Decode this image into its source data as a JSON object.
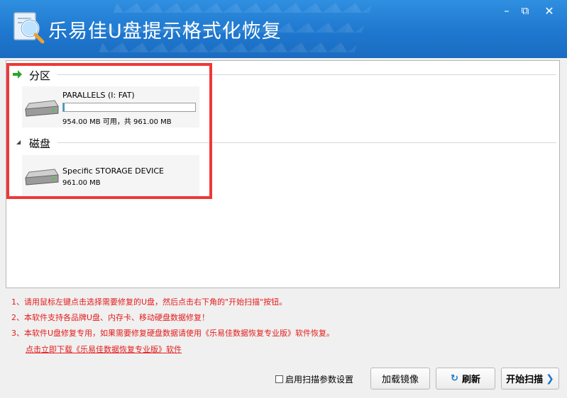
{
  "window": {
    "title": "乐易佳U盘提示格式化恢复",
    "minimize_symbol": "–",
    "maximize_symbol": "⧉",
    "close_symbol": "✕"
  },
  "sections": {
    "partitions": {
      "label": "分区",
      "items": [
        {
          "name": "PARALLELS (I: FAT)",
          "free_text": "954.00 MB 可用，共 961.00 MB",
          "used_fraction": 0.007,
          "icon": "hard-drive-icon"
        }
      ]
    },
    "disks": {
      "label": "磁盘",
      "items": [
        {
          "name": "Specific STORAGE DEVICE",
          "size_text": "961.00 MB",
          "icon": "hard-drive-icon"
        }
      ]
    }
  },
  "tips": {
    "lines": [
      "1、请用鼠标左键点击选择需要修复的U盘，然后点击右下角的\"开始扫描\"按钮。",
      "2、本软件支持各品牌U盘、内存卡、移动硬盘数据修复！",
      "3、本软件U盘修复专用，如果需要修复硬盘数据请使用《乐易佳数据恢复专业版》软件恢复。"
    ],
    "download_link": "点击立即下载《乐易佳数据恢复专业版》软件"
  },
  "footer": {
    "checkbox_label": "启用扫描参数设置",
    "checkbox_checked": false,
    "load_image_label": "加载镜像",
    "refresh_label": "刷新",
    "start_scan_label": "开始扫描"
  },
  "colors": {
    "title_bar": "#1f78cf",
    "highlight_border": "#ee3838",
    "tip_text": "#e41b1b",
    "accent": "#1a78cf"
  }
}
